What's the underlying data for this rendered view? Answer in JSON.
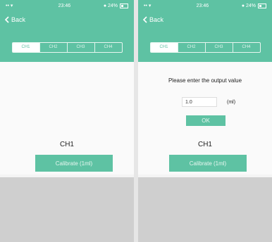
{
  "status": {
    "signal": "•• ▾",
    "time": "23:46",
    "battery": "● 24%"
  },
  "back_label": "Back",
  "tabs": [
    "CH1",
    "CH2",
    "CH3",
    "CH4"
  ],
  "left": {
    "channel_label": "CH1",
    "calibrate_label": "Calibrate (1ml)"
  },
  "right": {
    "prompt": "Please enter the output value",
    "input_value": "1.0",
    "unit": "(ml)",
    "ok_label": "OK",
    "channel_label": "CH1",
    "calibrate_label": "Calibrate (1ml)"
  },
  "colors": {
    "accent": "#5ec2a3"
  }
}
